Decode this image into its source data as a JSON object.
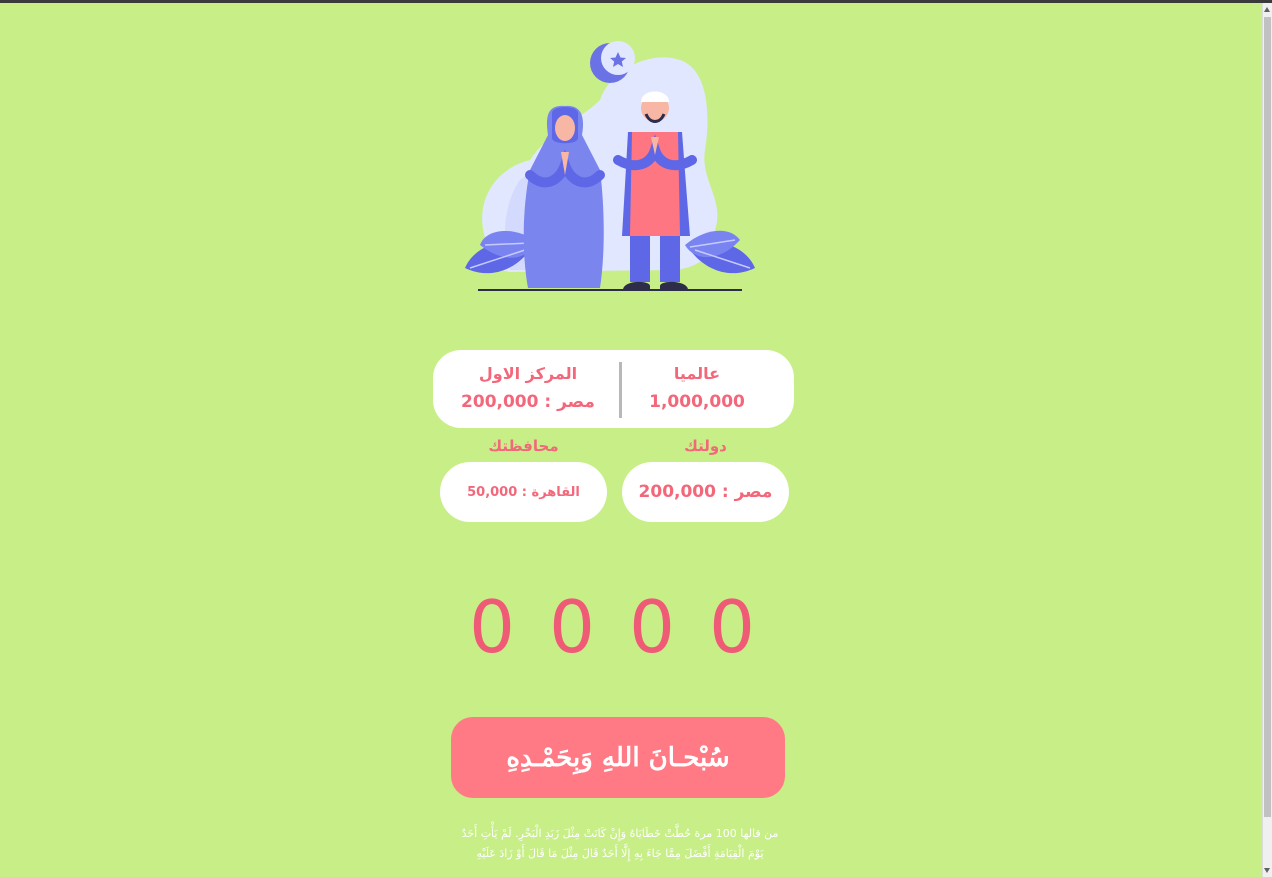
{
  "ranking": {
    "global_title": "عالميا",
    "global_value": "1,000,000",
    "first_place_title": "المركز الاول",
    "first_place_value": "مصر : 200,000"
  },
  "country": {
    "label": "دولتك",
    "value": "مصر : 200,000"
  },
  "governorate": {
    "label": "محافظتك",
    "value": "القاهرة : 50,000"
  },
  "counter": {
    "digits": [
      "0",
      "0",
      "0",
      "0"
    ]
  },
  "tasbih_button": {
    "label": "سُبْحـانَ اللهِ وَبِحَمْـدِهِ"
  },
  "hadith": {
    "line1": "من قالها 100 مرة حُطَّتْ خَطَايَاهُ وَإِنْ كَانَتْ مِثْلَ زَبَدِ الْبَحْرِ. لَمْ يَأْتِ أَحَدٌ",
    "line2": "يَوْمَ الْقِيَامَةِ أَفْضَلَ مِمَّا جَاءَ بِهِ إِلَّا أَحَدٌ قَالَ مِثْلَ مَا قَالَ أَوْ زَادَ عَلَيْهِ"
  },
  "colors": {
    "background": "#c8ef87",
    "accent": "#f3677b",
    "button": "#ff7a85"
  },
  "icons": [
    "crescent-moon-icon",
    "star-icon"
  ]
}
